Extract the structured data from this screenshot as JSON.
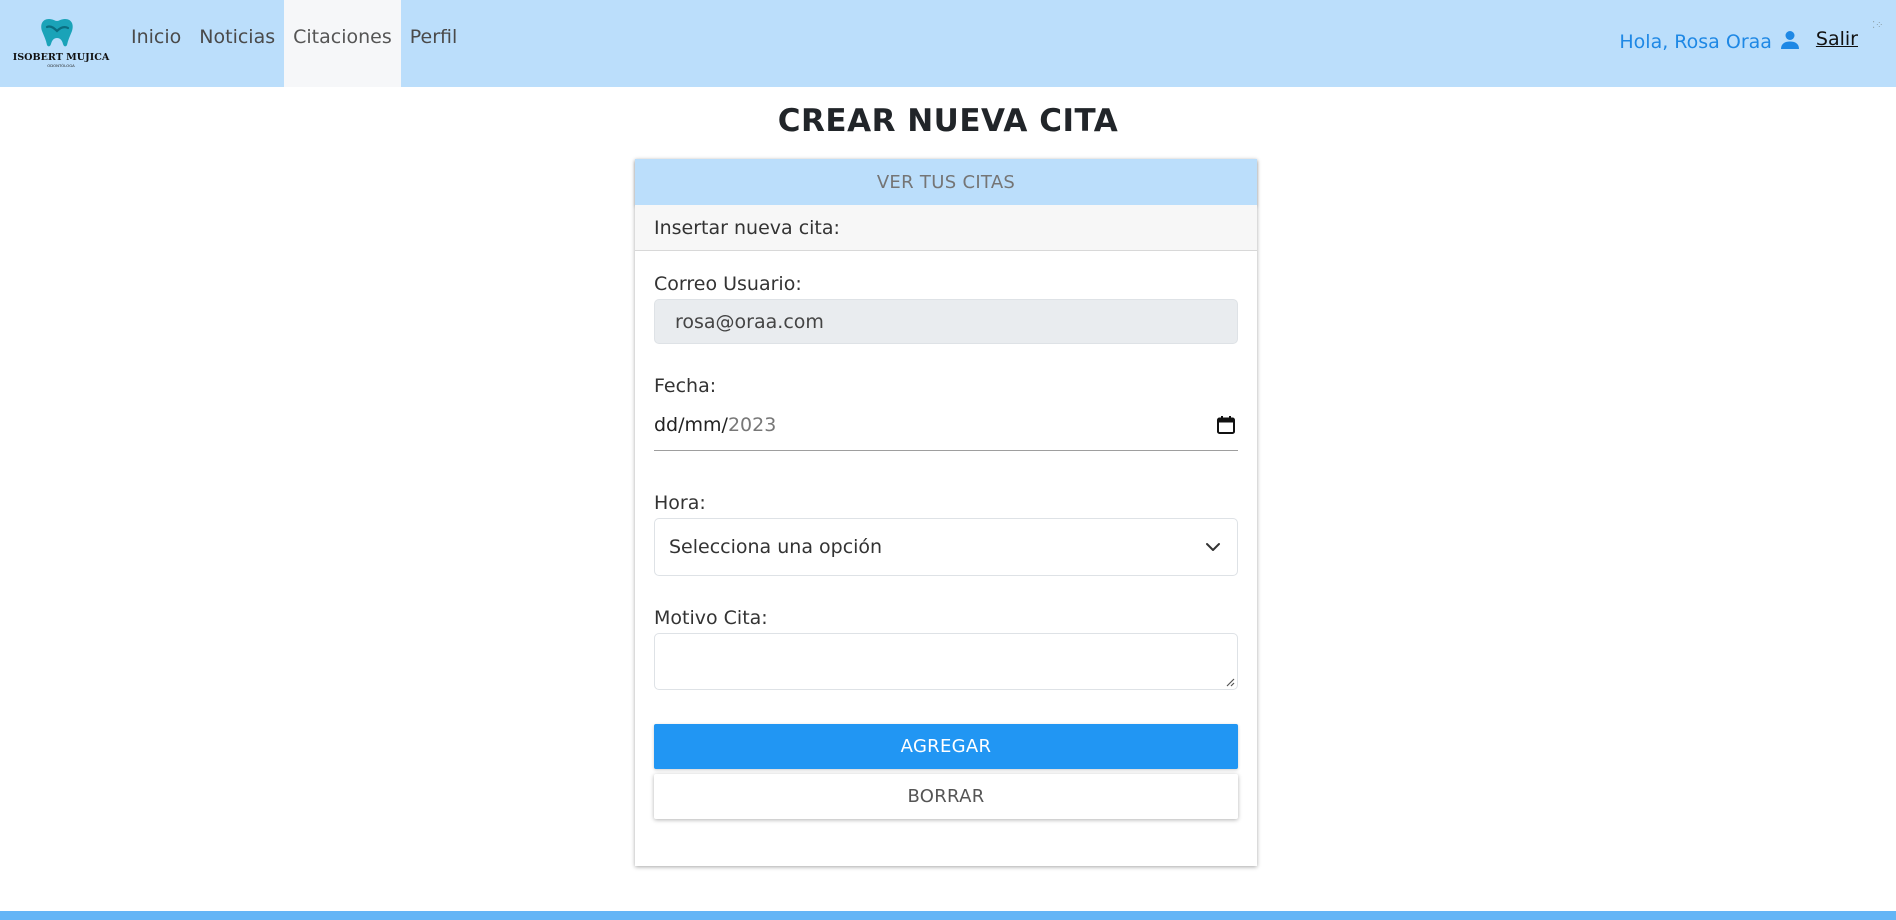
{
  "brand": {
    "name": "ISOBERT MUJICA",
    "subtitle": "ODONTÓLOGA"
  },
  "nav": {
    "items": [
      {
        "label": "Inicio"
      },
      {
        "label": "Noticias"
      },
      {
        "label": "Citaciones",
        "active": true
      },
      {
        "label": "Perfil"
      }
    ],
    "greeting": "Hola, Rosa Oraa",
    "logout": "Salir"
  },
  "page": {
    "title": "CREAR NUEVA CITA"
  },
  "card": {
    "top_button": "VER TUS CITAS",
    "header": "Insertar nueva cita:"
  },
  "form": {
    "email_label": "Correo Usuario:",
    "email_value": "rosa@oraa.com",
    "date_label": "Fecha:",
    "date_mask": "dd/mm/",
    "date_year": "2023",
    "hour_label": "Hora:",
    "hour_selected": "Selecciona una opción",
    "reason_label": "Motivo Cita:",
    "reason_value": "",
    "add_button": "AGREGAR",
    "clear_button": "BORRAR"
  },
  "colors": {
    "navbar": "#bbdefb",
    "primary": "#2196f3",
    "greeting": "#1e88e5",
    "footer": "#64b5f6"
  },
  "icons": {
    "logo": "tooth-logo-icon",
    "user": "user-icon",
    "calendar": "calendar-icon",
    "chevron": "chevron-down-icon",
    "resize": "resize-grip-icon",
    "spinner": "loading-dots-icon"
  }
}
